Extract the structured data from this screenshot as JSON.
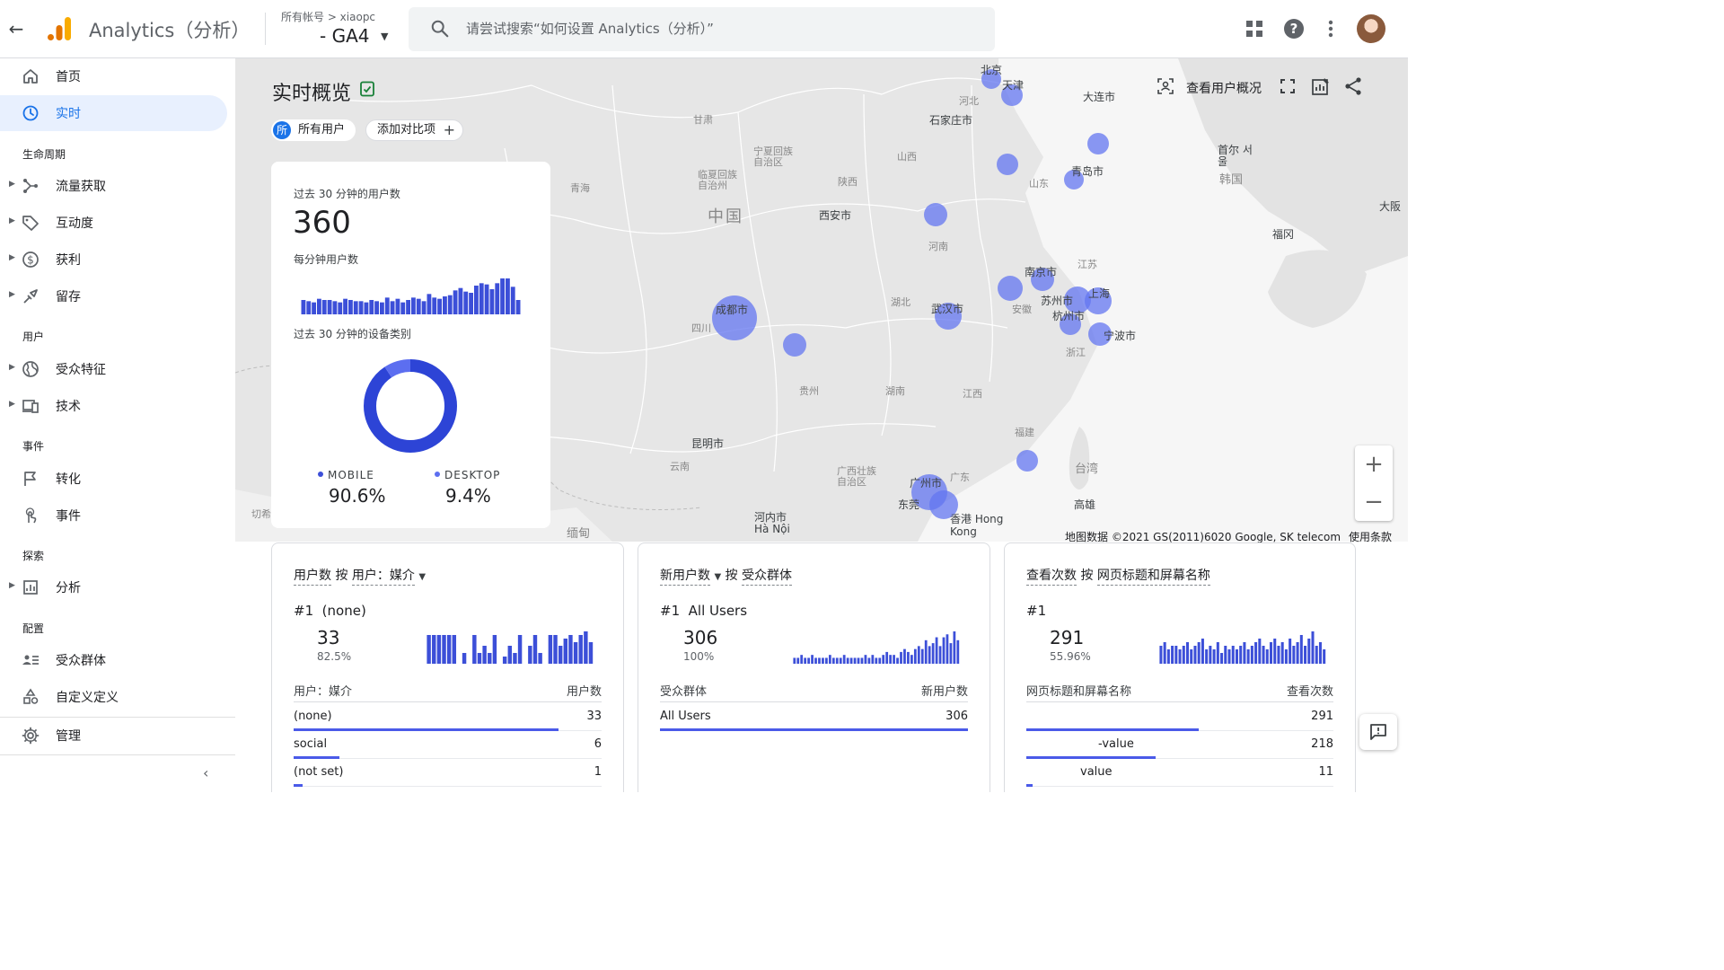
{
  "header": {
    "product_name": "Analytics（分析）",
    "account_path": "所有帐号 > xiaopc",
    "property_name": "- GA4",
    "search_placeholder": "请尝试搜索“如何设置 Analytics（分析）”"
  },
  "sidebar": {
    "items_top": [
      {
        "label": "首页",
        "icon": "home-icon"
      },
      {
        "label": "实时",
        "icon": "clock-icon",
        "active": true
      }
    ],
    "sections": {
      "lifecycle": "生命周期",
      "user": "用户",
      "events": "事件",
      "explore": "探索",
      "config": "配置"
    },
    "lifecycle_items": [
      {
        "label": "流量获取",
        "icon": "acquisition-icon"
      },
      {
        "label": "互动度",
        "icon": "tag-icon"
      },
      {
        "label": "获利",
        "icon": "dollar-icon"
      },
      {
        "label": "留存",
        "icon": "retention-icon"
      }
    ],
    "user_items": [
      {
        "label": "受众特征",
        "icon": "globe-icon"
      },
      {
        "label": "技术",
        "icon": "devices-icon"
      }
    ],
    "event_items": [
      {
        "label": "转化",
        "icon": "flag-icon"
      },
      {
        "label": "事件",
        "icon": "touch-icon"
      }
    ],
    "explore_items": [
      {
        "label": "分析",
        "icon": "analysis-icon"
      }
    ],
    "config_items": [
      {
        "label": "受众群体",
        "icon": "audience-icon"
      },
      {
        "label": "自定义定义",
        "icon": "shapes-icon"
      }
    ],
    "admin": {
      "label": "管理",
      "icon": "gear-icon"
    }
  },
  "page": {
    "title": "实时概览",
    "chip_all_badge": "所",
    "chip_all": "所有用户",
    "chip_compare": "添加对比项",
    "view_user_overview": "查看用户概况"
  },
  "map": {
    "country_label": "中国",
    "attribution": "地图数据 ©2021 GS(2011)6020 Google, SK telecom",
    "terms": "使用条款",
    "labels": [
      "北京",
      "天津",
      "大连市",
      "石家庄市",
      "河北",
      "甘肃",
      "宁夏回族自治区",
      "山西",
      "首尔 서울",
      "韩国",
      "临夏回族自治州",
      "陕西",
      "青海",
      "青岛市",
      "山东",
      "西安市",
      "大阪",
      "福冈",
      "河南",
      "南京市",
      "江苏",
      "湖北",
      "武汉市",
      "苏州市",
      "上海",
      "杭州市",
      "安徽",
      "成都市",
      "四川",
      "宁波市",
      "浙江",
      "贵州",
      "湖南",
      "江西",
      "福建",
      "台湾",
      "昆明市",
      "云南",
      "广西壮族自治区",
      "广州市",
      "广东",
      "东莞",
      "香港 Hong Kong",
      "高雄",
      "河内市 Hà Nội",
      "缅甸",
      "切希"
    ]
  },
  "realtime_card": {
    "users_label": "过去 30 分钟的用户数",
    "users_value": "360",
    "per_minute_label": "每分钟用户数",
    "per_minute_values": [
      12,
      11,
      10,
      13,
      12,
      12,
      11,
      10,
      13,
      12,
      11,
      11,
      10,
      12,
      11,
      10,
      14,
      11,
      13,
      10,
      12,
      14,
      13,
      11,
      17,
      14,
      13,
      15,
      16,
      20,
      22,
      19,
      18,
      24,
      26,
      25,
      21,
      26,
      30,
      30,
      23,
      12
    ],
    "device_label": "过去 30 分钟的设备类别",
    "devices": [
      {
        "name": "MOBILE",
        "value": "90.6%",
        "share": 0.906
      },
      {
        "name": "DESKTOP",
        "value": "9.4%",
        "share": 0.094
      }
    ]
  },
  "cards": [
    {
      "title_metric": "用户数",
      "title_by": "按",
      "title_dim": "用户：媒介",
      "has_dropdown": true,
      "rank": "#1",
      "rank_name": "(none)",
      "value": "33",
      "pct": "82.5%",
      "spark": [
        8,
        8,
        8,
        8,
        8,
        8,
        0,
        3,
        0,
        8,
        3,
        5,
        3,
        8,
        0,
        2,
        5,
        3,
        8,
        0,
        5,
        8,
        3,
        0,
        8,
        8,
        5,
        7,
        8,
        6,
        8,
        9,
        6
      ],
      "col_left": "用户：媒介",
      "col_right": "用户数",
      "rows": [
        {
          "label": "(none)",
          "value": "33",
          "share": 0.86
        },
        {
          "label": "social",
          "value": "6",
          "share": 0.15
        },
        {
          "label": "(not set)",
          "value": "1",
          "share": 0.03
        }
      ]
    },
    {
      "title_metric": "新用户数",
      "title_by": "按",
      "title_dim": "受众群体",
      "has_dropdown": true,
      "rank": "#1",
      "rank_name": "All Users",
      "value": "306",
      "pct": "100%",
      "spark": [
        2,
        2,
        3,
        2,
        2,
        3,
        2,
        2,
        2,
        2,
        3,
        2,
        2,
        2,
        3,
        2,
        2,
        2,
        2,
        2,
        3,
        2,
        3,
        2,
        2,
        3,
        4,
        3,
        3,
        2,
        4,
        5,
        4,
        3,
        5,
        6,
        5,
        8,
        6,
        7,
        9,
        6,
        9,
        10,
        7,
        11,
        8
      ],
      "col_left": "受众群体",
      "col_right": "新用户数",
      "rows": [
        {
          "label": "All Users",
          "value": "306",
          "share": 1.0
        }
      ]
    },
    {
      "title_metric": "查看次数",
      "title_by": "按",
      "title_dim": "网页标题和屏幕名称",
      "has_dropdown": false,
      "rank": "#1",
      "rank_name": "",
      "value": "291",
      "pct": "55.96%",
      "spark": [
        5,
        6,
        4,
        5,
        5,
        4,
        5,
        6,
        4,
        5,
        6,
        7,
        4,
        5,
        4,
        6,
        3,
        5,
        4,
        5,
        4,
        5,
        6,
        4,
        5,
        6,
        7,
        5,
        4,
        6,
        7,
        5,
        6,
        4,
        7,
        5,
        6,
        8,
        5,
        7,
        9,
        5,
        6,
        4
      ],
      "col_left": "网页标题和屏幕名称",
      "col_right": "查看次数",
      "rows": [
        {
          "label": "",
          "value": "291",
          "share": 0.56
        },
        {
          "label": "-value",
          "value": "218",
          "share": 0.42
        },
        {
          "label": "value",
          "value": "11",
          "share": 0.02
        }
      ]
    }
  ],
  "colors": {
    "accent": "#1a73e8",
    "bar_blue": "#3c4fd8",
    "dot_blue": "#6375f0"
  }
}
